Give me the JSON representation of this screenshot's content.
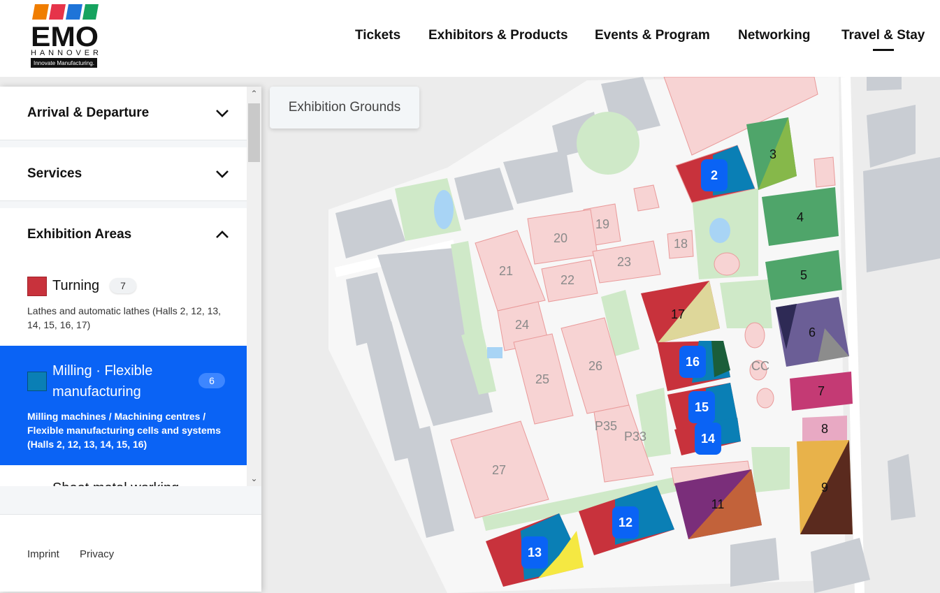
{
  "logo": {
    "brand": "EMO",
    "city": "HANNOVER",
    "tagline": "Innovate Manufacturing.",
    "stripe_colors": [
      "#f07d00",
      "#e6344a",
      "#1e74d8",
      "#16a35f"
    ]
  },
  "nav": {
    "items": [
      "Tickets",
      "Exhibitors & Products",
      "Events & Program",
      "Networking",
      "Travel & Stay"
    ],
    "active": "Travel & Stay"
  },
  "map": {
    "chip": "Exhibition Grounds",
    "hall_labels": [
      "2",
      "3",
      "4",
      "5",
      "6",
      "7",
      "8",
      "9",
      "11",
      "12",
      "13",
      "14",
      "15",
      "16",
      "17",
      "18",
      "19",
      "20",
      "21",
      "22",
      "23",
      "24",
      "25",
      "26",
      "27",
      "CC",
      "P35",
      "P33"
    ],
    "highlighted_halls": [
      "2",
      "12",
      "13",
      "14",
      "15",
      "16"
    ]
  },
  "sidebar": {
    "sections": [
      {
        "title": "Arrival & Departure",
        "expanded": false
      },
      {
        "title": "Services",
        "expanded": false
      },
      {
        "title": "Exhibition Areas",
        "expanded": true
      }
    ],
    "categories": [
      {
        "name": "Turning",
        "count": "7",
        "color": "#c8323c",
        "description": "Lathes and automatic lathes (Halls 2, 12, 13, 14, 15, 16, 17)",
        "selected": false
      },
      {
        "name_line1": "Milling · Flexible",
        "name_line2": "manufacturing",
        "count": "6",
        "color": "#0a7fb5",
        "description": "Milling machines / Machining centres / Flexible manufacturing cells and systems (Halls 2, 12, 13, 14, 15, 16)",
        "selected": true
      },
      {
        "name": "Sheet metal working",
        "partially_visible": true
      }
    ]
  },
  "footer": {
    "links": [
      "Imprint",
      "Privacy"
    ]
  },
  "colors": {
    "accent": "#0a63f5",
    "hall_pink": "#f7d3d3",
    "green_area": "#cfe9c8"
  }
}
